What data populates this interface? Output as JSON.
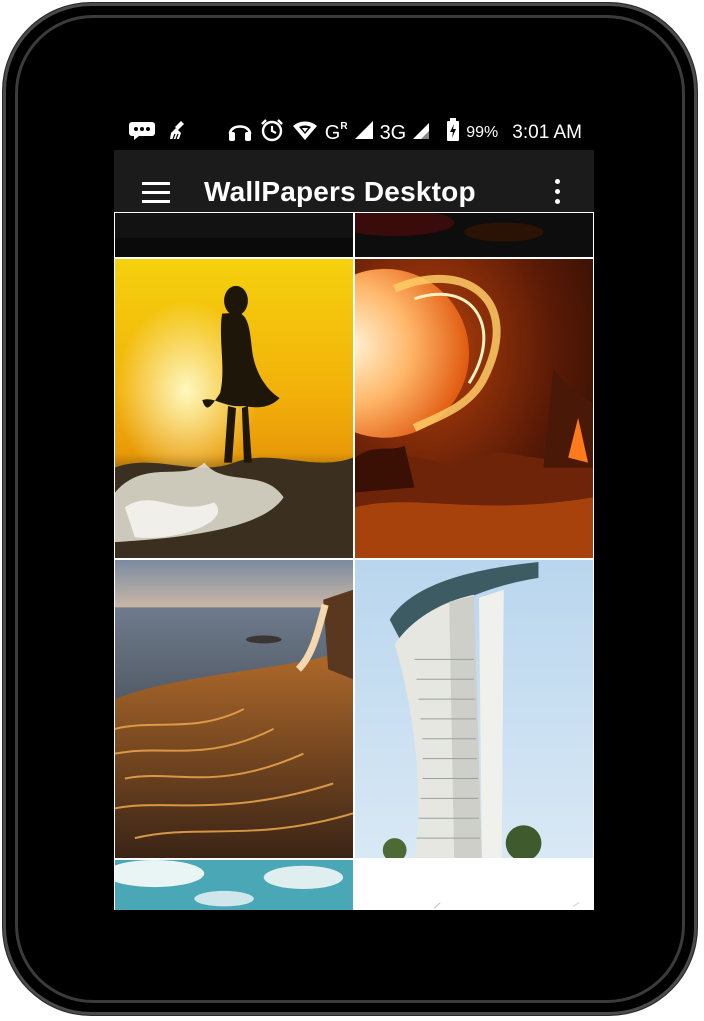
{
  "device": {
    "frame_color": "#000000"
  },
  "status_bar": {
    "icons_left": [
      "message-icon",
      "cleaner-icon"
    ],
    "icons_right": [
      "headphones-icon",
      "alarm-icon",
      "wifi-icon",
      "signal-icon",
      "battery-icon"
    ],
    "network_1": "G",
    "network_1_sup": "R",
    "network_2": "3G",
    "battery": "99%",
    "time": "3:01 AM"
  },
  "app_bar": {
    "title": "WallPapers Desktop",
    "menu_icon": "hamburger-menu-icon",
    "overflow_icon": "more-vert-icon",
    "background": "#1b1b1b"
  },
  "wallpapers": [
    {
      "name": "top-left partial",
      "theme": "dark"
    },
    {
      "name": "top-right partial",
      "theme": "dark red"
    },
    {
      "name": "woman in waves at sunset",
      "theme": "golden sunset"
    },
    {
      "name": "solar flare over lava planet",
      "theme": "fiery orange"
    },
    {
      "name": "waterfall on golden rock coast",
      "theme": "sunset seascape"
    },
    {
      "name": "curved skyscraper towers",
      "theme": "blue sky architecture"
    },
    {
      "name": "bottom-left partial",
      "theme": "sky with clouds"
    },
    {
      "name": "bottom-right partial",
      "theme": "white"
    }
  ]
}
